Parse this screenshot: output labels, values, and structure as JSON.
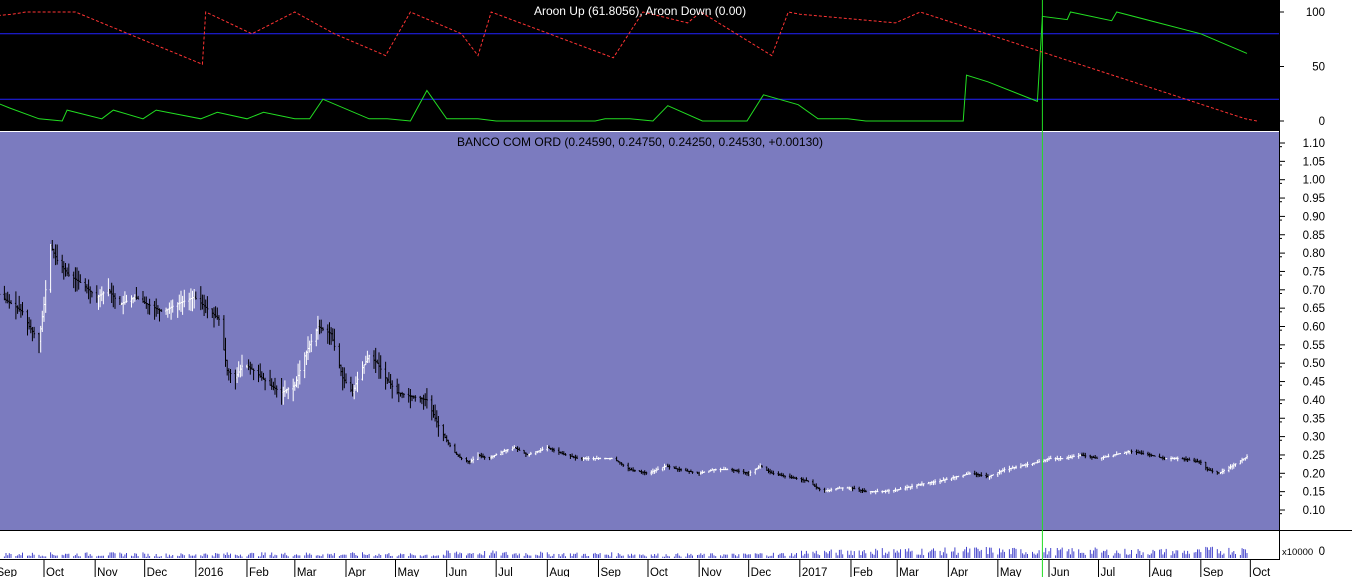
{
  "chart_data": [
    {
      "type": "line",
      "panel": "aroon",
      "title": "Aroon Up (61.8056), Aroon Down (0.00)",
      "ylim": [
        -5,
        105
      ],
      "yticks": [
        "100",
        "50",
        "0"
      ],
      "reference_lines": [
        80,
        20
      ],
      "background": "#000000",
      "colors": {
        "up": "#22dd22",
        "down": "#ff3333",
        "ref": "#2222ff"
      },
      "series": [
        {
          "name": "Aroon Up",
          "x": [
            "2015-08-28",
            "2015-09-10",
            "2015-09-28",
            "2015-10-12",
            "2015-10-15",
            "2015-11-05",
            "2015-11-12",
            "2015-11-30",
            "2015-12-08",
            "2016-01-04",
            "2016-01-14",
            "2016-02-01",
            "2016-02-11",
            "2016-03-01",
            "2016-03-10",
            "2016-03-18",
            "2016-04-15",
            "2016-04-26",
            "2016-05-10",
            "2016-05-20",
            "2016-06-01",
            "2016-06-20",
            "2016-07-01",
            "2016-07-04",
            "2016-08-18",
            "2016-08-30",
            "2016-09-05",
            "2016-09-20",
            "2016-10-04",
            "2016-10-13",
            "2016-11-03",
            "2016-11-10",
            "2016-11-30",
            "2016-12-10",
            "2016-12-31",
            "2017-01-12",
            "2017-01-30",
            "2017-02-10",
            "2017-02-28",
            "2017-03-30",
            "2017-04-10",
            "2017-04-12",
            "2017-04-25",
            "2017-05-25",
            "2017-05-28",
            "2017-06-12",
            "2017-06-14",
            "2017-07-09",
            "2017-07-12",
            "2017-09-01",
            "2017-09-29"
          ],
          "y": [
            20,
            12,
            2,
            0,
            10,
            2,
            10,
            2,
            10,
            2,
            8,
            2,
            8,
            2,
            2,
            20,
            2,
            2,
            0,
            28,
            2,
            2,
            0,
            0,
            0,
            0,
            2,
            2,
            0,
            14,
            0,
            0,
            0,
            24,
            15,
            2,
            2,
            0,
            0,
            0,
            0,
            42,
            36,
            18,
            96,
            93,
            100,
            92,
            100,
            80,
            62
          ]
        },
        {
          "name": "Aroon Down",
          "x": [
            "2015-08-28",
            "2015-09-12",
            "2015-09-20",
            "2015-10-20",
            "2016-01-05",
            "2016-01-07",
            "2016-02-04",
            "2016-03-01",
            "2016-03-25",
            "2016-04-25",
            "2016-05-10",
            "2016-06-10",
            "2016-06-20",
            "2016-06-28",
            "2016-09-10",
            "2016-09-28",
            "2016-10-25",
            "2016-11-02",
            "2016-12-15",
            "2016-12-25",
            "2017-01-01",
            "2017-02-28",
            "2017-03-15",
            "2017-09-28",
            "2017-10-05"
          ],
          "y": [
            96,
            98,
            100,
            100,
            52,
            100,
            80,
            100,
            80,
            60,
            100,
            80,
            60,
            100,
            58,
            100,
            90,
            100,
            60,
            100,
            98,
            90,
            100,
            2,
            0
          ]
        }
      ]
    },
    {
      "type": "line",
      "panel": "price",
      "title": "BANCO COM ORD (0.24590, 0.24750, 0.24250, 0.24530, +0.00130)",
      "ylim": [
        0.05,
        1.13
      ],
      "yticks": [
        "1.10",
        "1.05",
        "1.00",
        "0.95",
        "0.90",
        "0.85",
        "0.80",
        "0.75",
        "0.70",
        "0.65",
        "0.60",
        "0.55",
        "0.50",
        "0.45",
        "0.40",
        "0.35",
        "0.30",
        "0.25",
        "0.20",
        "0.15",
        "0.10"
      ],
      "background": "#7b7bbf",
      "series": [
        {
          "name": "BANCO COM ORD",
          "x": [
            "2015-08-28",
            "2015-09-05",
            "2015-09-12",
            "2015-09-18",
            "2015-09-22",
            "2015-09-28",
            "2015-10-01",
            "2015-10-05",
            "2015-10-09",
            "2015-10-16",
            "2015-10-23",
            "2015-11-02",
            "2015-11-09",
            "2015-11-16",
            "2015-11-25",
            "2015-12-03",
            "2015-12-12",
            "2015-12-20",
            "2015-12-31",
            "2016-01-10",
            "2016-01-15",
            "2016-01-20",
            "2016-01-25",
            "2016-01-30",
            "2016-02-05",
            "2016-02-15",
            "2016-02-22",
            "2016-03-01",
            "2016-03-07",
            "2016-03-15",
            "2016-03-23",
            "2016-03-30",
            "2016-04-05",
            "2016-04-10",
            "2016-04-15",
            "2016-04-20",
            "2016-04-25",
            "2016-05-02",
            "2016-05-10",
            "2016-05-20",
            "2016-05-28",
            "2016-06-05",
            "2016-06-10",
            "2016-06-15",
            "2016-06-20",
            "2016-06-26",
            "2016-07-05",
            "2016-07-12",
            "2016-07-20",
            "2016-08-01",
            "2016-08-12",
            "2016-08-20",
            "2016-09-01",
            "2016-09-10",
            "2016-09-20",
            "2016-10-01",
            "2016-10-12",
            "2016-10-20",
            "2016-11-01",
            "2016-11-10",
            "2016-11-20",
            "2016-12-01",
            "2016-12-08",
            "2016-12-15",
            "2016-12-25",
            "2017-01-05",
            "2017-01-15",
            "2017-01-25",
            "2017-02-01",
            "2017-02-10",
            "2017-02-20",
            "2017-03-01",
            "2017-03-15",
            "2017-03-28",
            "2017-04-05",
            "2017-04-15",
            "2017-04-25",
            "2017-05-05",
            "2017-05-15",
            "2017-05-25",
            "2017-06-01",
            "2017-06-10",
            "2017-06-20",
            "2017-07-01",
            "2017-07-10",
            "2017-07-20",
            "2017-08-01",
            "2017-08-10",
            "2017-08-20",
            "2017-09-01",
            "2017-09-05",
            "2017-09-12",
            "2017-09-20",
            "2017-09-29"
          ],
          "y": [
            0.74,
            0.68,
            0.66,
            0.64,
            0.6,
            0.56,
            0.66,
            0.82,
            0.78,
            0.74,
            0.72,
            0.68,
            0.7,
            0.66,
            0.68,
            0.66,
            0.64,
            0.66,
            0.68,
            0.64,
            0.62,
            0.48,
            0.46,
            0.5,
            0.48,
            0.44,
            0.42,
            0.44,
            0.52,
            0.6,
            0.58,
            0.46,
            0.42,
            0.48,
            0.52,
            0.5,
            0.46,
            0.42,
            0.41,
            0.4,
            0.32,
            0.26,
            0.24,
            0.23,
            0.25,
            0.24,
            0.26,
            0.27,
            0.25,
            0.27,
            0.25,
            0.24,
            0.24,
            0.24,
            0.21,
            0.2,
            0.22,
            0.21,
            0.2,
            0.21,
            0.21,
            0.2,
            0.22,
            0.2,
            0.19,
            0.18,
            0.15,
            0.16,
            0.16,
            0.15,
            0.15,
            0.155,
            0.17,
            0.18,
            0.19,
            0.2,
            0.19,
            0.21,
            0.22,
            0.23,
            0.24,
            0.24,
            0.25,
            0.24,
            0.25,
            0.26,
            0.25,
            0.24,
            0.24,
            0.23,
            0.21,
            0.2,
            0.22,
            0.245
          ]
        }
      ]
    },
    {
      "type": "bar",
      "panel": "volume",
      "unit_label": "x10000",
      "yticks": [
        "0"
      ],
      "x": [
        "2015-09",
        "2015-10",
        "2015-11",
        "2015-12",
        "2016-01",
        "2016-02",
        "2016-03",
        "2016-04",
        "2016-05",
        "2016-06",
        "2016-07",
        "2016-08",
        "2016-09",
        "2016-10",
        "2016-11",
        "2016-12",
        "2017-01",
        "2017-02",
        "2017-03",
        "2017-04",
        "2017-05",
        "2017-06",
        "2017-07",
        "2017-08",
        "2017-09"
      ],
      "values": [
        0.3,
        0.3,
        0.3,
        0.25,
        0.3,
        0.3,
        0.3,
        0.3,
        0.25,
        0.4,
        0.35,
        0.3,
        0.3,
        0.25,
        0.25,
        0.3,
        0.45,
        0.55,
        0.55,
        0.6,
        0.55,
        0.55,
        0.5,
        0.5,
        0.6
      ]
    }
  ],
  "x_axis": {
    "labels": [
      "Sep",
      "Oct",
      "Nov",
      "Dec",
      "2016",
      "Feb",
      "Mar",
      "Apr",
      "May",
      "Jun",
      "Jul",
      "Aug",
      "Sep",
      "Oct",
      "Nov",
      "Dec",
      "2017",
      "Feb",
      "Mar",
      "Apr",
      "May",
      "Jun",
      "Jul",
      "Aug",
      "Sep",
      "Oct"
    ],
    "dates": [
      "2015-09-01",
      "2015-10-01",
      "2015-11-01",
      "2015-12-01",
      "2016-01-01",
      "2016-02-01",
      "2016-03-01",
      "2016-04-01",
      "2016-05-01",
      "2016-06-01",
      "2016-07-01",
      "2016-08-01",
      "2016-09-01",
      "2016-10-01",
      "2016-11-01",
      "2016-12-01",
      "2017-01-01",
      "2017-02-01",
      "2017-03-01",
      "2017-04-01",
      "2017-05-01",
      "2017-06-01",
      "2017-07-01",
      "2017-08-01",
      "2017-09-01",
      "2017-10-01"
    ]
  },
  "crosshair": {
    "date": "2017-05-28",
    "color": "#22dd22"
  }
}
